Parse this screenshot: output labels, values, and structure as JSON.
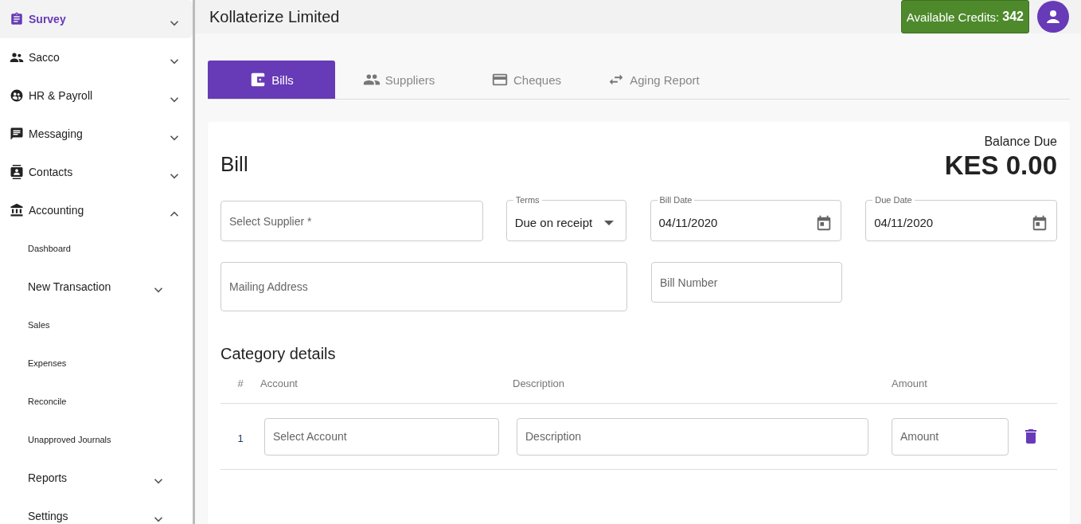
{
  "sidebar": {
    "items": [
      {
        "label": "Survey",
        "selected": true,
        "expanded": false
      },
      {
        "label": "Sacco",
        "selected": false,
        "expanded": false
      },
      {
        "label": "HR & Payroll",
        "selected": false,
        "expanded": false
      },
      {
        "label": "Messaging",
        "selected": false,
        "expanded": false
      },
      {
        "label": "Contacts",
        "selected": false,
        "expanded": false
      },
      {
        "label": "Accounting",
        "selected": false,
        "expanded": true,
        "children": [
          {
            "label": "Dashboard",
            "kind": "link"
          },
          {
            "label": "New Transaction",
            "kind": "group",
            "expanded": false
          },
          {
            "label": "Sales",
            "kind": "link"
          },
          {
            "label": "Expenses",
            "kind": "link"
          },
          {
            "label": "Reconcile",
            "kind": "link"
          },
          {
            "label": "Unapproved Journals",
            "kind": "link"
          },
          {
            "label": "Reports",
            "kind": "group",
            "expanded": false
          },
          {
            "label": "Settings",
            "kind": "group",
            "expanded": false
          }
        ]
      }
    ]
  },
  "header": {
    "company": "Kollaterize Limited",
    "credits_label": "Available Credits:",
    "credits_value": "342"
  },
  "tabs": [
    {
      "label": "Bills",
      "selected": true
    },
    {
      "label": "Suppliers",
      "selected": false
    },
    {
      "label": "Cheques",
      "selected": false
    },
    {
      "label": "Aging Report",
      "selected": false
    }
  ],
  "bill": {
    "title": "Bill",
    "balance_label": "Balance Due",
    "balance_value": "KES 0.00",
    "supplier": {
      "placeholder": "Select Supplier *"
    },
    "terms": {
      "label": "Terms",
      "value": "Due on receipt"
    },
    "bill_date": {
      "label": "Bill Date",
      "value": "04/11/2020"
    },
    "due_date": {
      "label": "Due Date",
      "value": "04/11/2020"
    },
    "mailing_address": {
      "placeholder": "Mailing Address"
    },
    "bill_number": {
      "placeholder": "Bill Number"
    }
  },
  "category_details": {
    "title": "Category details",
    "columns": [
      "#",
      "Account",
      "Description",
      "Amount"
    ],
    "rows": [
      {
        "number": "1",
        "account": {
          "placeholder": "Select Account"
        },
        "description": {
          "placeholder": "Description"
        },
        "amount": {
          "placeholder": "Amount"
        }
      }
    ]
  }
}
